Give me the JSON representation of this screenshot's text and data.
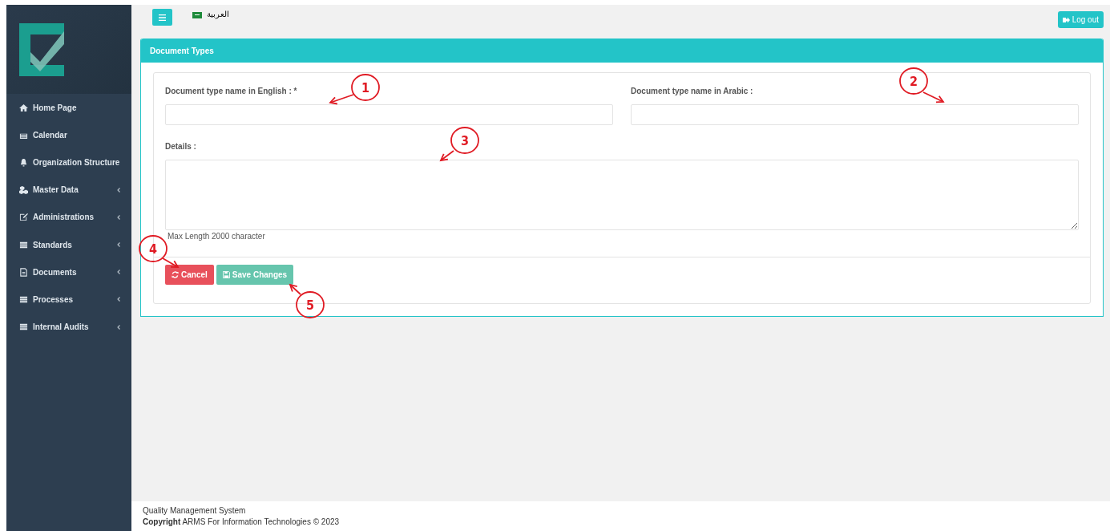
{
  "topbar": {
    "language": "العربية",
    "logout": "Log out"
  },
  "sidebar": {
    "items": [
      {
        "label": "Home Page",
        "expandable": false
      },
      {
        "label": "Calendar",
        "expandable": false
      },
      {
        "label": "Organization Structure",
        "expandable": false
      },
      {
        "label": "Master Data",
        "expandable": true
      },
      {
        "label": "Administrations",
        "expandable": true
      },
      {
        "label": "Standards",
        "expandable": true
      },
      {
        "label": "Documents",
        "expandable": true
      },
      {
        "label": "Processes",
        "expandable": true
      },
      {
        "label": "Internal Audits",
        "expandable": true
      }
    ]
  },
  "panel": {
    "title": "Document Types",
    "fields": [
      {
        "label": "Document type name in English : *"
      },
      {
        "label": "Document type name in Arabic :"
      }
    ],
    "details": {
      "label": "Details :",
      "hint": "Max Length 2000 character"
    },
    "buttons": [
      {
        "label": "Cancel",
        "kind": "cancel"
      },
      {
        "label": "Save Changes",
        "kind": "save"
      }
    ]
  },
  "annotations": [
    {
      "label": "1"
    },
    {
      "label": "2"
    },
    {
      "label": "3"
    },
    {
      "label": "4"
    },
    {
      "label": "5"
    }
  ],
  "footer": {
    "line": "Quality Management System",
    "copyright": "**Copyright** ARMS For Information Technologies © 2023"
  }
}
